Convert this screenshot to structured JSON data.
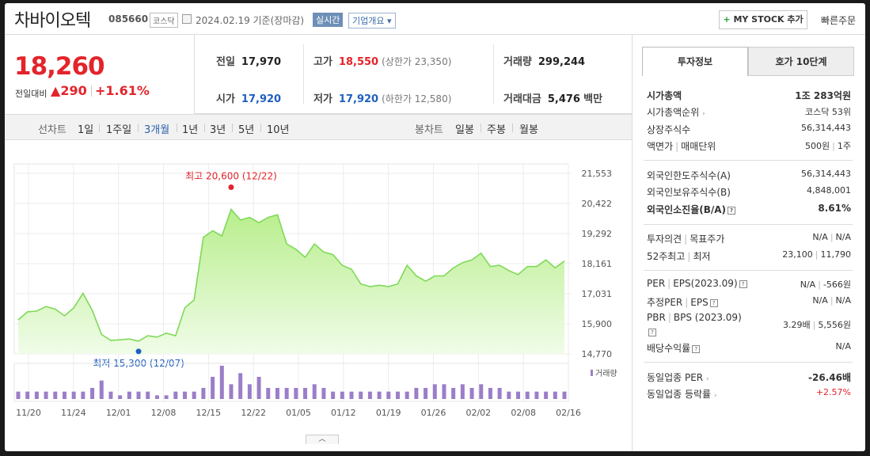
{
  "header": {
    "name": "차바이오텍",
    "code": "085660",
    "market": "코스닥",
    "date": "2024.02.19 기준(장마감)",
    "realtime": "실시간",
    "overview": "기업개요",
    "mystock": "MY STOCK 추가",
    "quick": "빠른주문"
  },
  "price": {
    "current": "18,260",
    "change_label": "전일대비",
    "change": "290",
    "change_pct": "+1.61%"
  },
  "quote": {
    "prev_k": "전일",
    "prev_v": "17,970",
    "high_k": "고가",
    "high_v": "18,550",
    "upper": "(상한가 23,350)",
    "vol_k": "거래량",
    "vol_v": "299,244",
    "open_k": "시가",
    "open_v": "17,920",
    "low_k": "저가",
    "low_v": "17,920",
    "lower": "(하한가 12,580)",
    "amt_k": "거래대금",
    "amt_v": "5,476",
    "amt_unit": "백만"
  },
  "toolbar": {
    "line_label": "선차트",
    "periods": [
      "1일",
      "1주일",
      "3개월",
      "1년",
      "3년",
      "5년",
      "10년"
    ],
    "active": "3개월",
    "candle_label": "봉차트",
    "candles": [
      "일봉",
      "주봉",
      "월봉"
    ]
  },
  "chart_data": {
    "type": "area",
    "y_ticks": [
      "21,553",
      "20,422",
      "19,292",
      "18,161",
      "17,031",
      "15,900",
      "14,770"
    ],
    "ylim": [
      14770,
      21553
    ],
    "x_ticks": [
      "11/20",
      "11/24",
      "12/01",
      "12/08",
      "12/15",
      "12/22",
      "01/05",
      "01/12",
      "01/19",
      "01/26",
      "02/02",
      "02/08",
      "02/16"
    ],
    "high_label": "최고 20,600 (12/22)",
    "low_label": "최저 15,300 (12/07)",
    "volume_label": "거래량",
    "colors": {
      "area": "#c9f2a8",
      "line": "#7ed957",
      "volume": "#9b7ec9",
      "high": "#e3242b",
      "low": "#1f5fbf"
    },
    "prices": [
      16050,
      16350,
      16380,
      16550,
      16450,
      16200,
      16500,
      17050,
      16400,
      15500,
      15280,
      15300,
      15330,
      15250,
      15450,
      15400,
      15550,
      15450,
      16500,
      16800,
      19150,
      19400,
      19200,
      20200,
      19800,
      19900,
      19700,
      19900,
      20000,
      18900,
      18700,
      18400,
      18900,
      18600,
      18500,
      18100,
      17950,
      17400,
      17300,
      17350,
      17300,
      17400,
      18100,
      17700,
      17500,
      17700,
      17700,
      18000,
      18200,
      18300,
      18550,
      18050,
      18100,
      17900,
      17750,
      18050,
      18050,
      18300,
      18000,
      18260
    ],
    "volumes": [
      2,
      2,
      2,
      2,
      2,
      2,
      2,
      2,
      3,
      5,
      2,
      1,
      2,
      2,
      2,
      1,
      1,
      2,
      2,
      2,
      3,
      6,
      9,
      4,
      7,
      4,
      6,
      3,
      3,
      3,
      3,
      3,
      4,
      3,
      2,
      2,
      2,
      2,
      2,
      2,
      2,
      2,
      2,
      3,
      3,
      4,
      4,
      3,
      4,
      3,
      4,
      3,
      3,
      2,
      2,
      2,
      2,
      2,
      2,
      2
    ]
  },
  "right": {
    "tab_on": "투자정보",
    "tab_off": "호가 10단계",
    "mktcap_k": "시가총액",
    "mktcap_v": "1조 283억원",
    "rank_k": "시가총액순위",
    "rank_v": "코스닥 53위",
    "shares_k": "상장주식수",
    "shares_v": "56,314,443",
    "face_k": "액면가",
    "trade_unit_k": "매매단위",
    "face_v": "500원",
    "unit_v": "1주",
    "foreign_limit_k": "외국인한도주식수(A)",
    "foreign_limit_v": "56,314,443",
    "foreign_hold_k": "외국인보유주식수(B)",
    "foreign_hold_v": "4,848,001",
    "foreign_ratio_k": "외국인소진율(B/A)",
    "foreign_ratio_v": "8.61%",
    "opinion_k": "투자의견",
    "target_k": "목표주가",
    "opinion_v": "N/A",
    "target_v": "N/A",
    "wk52_k": "52주최고",
    "wk52low_k": "최저",
    "wk52h_v": "23,100",
    "wk52l_v": "11,790",
    "per_k": "PER",
    "eps_k": "EPS(2023.09)",
    "per_v": "N/A",
    "eps_v": "-566원",
    "eper_k": "추정PER",
    "eeps_k": "EPS",
    "eper_v": "N/A",
    "eeps_v": "N/A",
    "pbr_k": "PBR",
    "bps_k": "BPS (2023.09)",
    "pbr_v": "3.29배",
    "bps_v": "5,556원",
    "div_k": "배당수익률",
    "div_v": "N/A",
    "sector_per_k": "동일업종 PER",
    "sector_per_v": "-26.46배",
    "sector_chg_k": "동일업종 등락률",
    "sector_chg_v": "+2.57%"
  }
}
